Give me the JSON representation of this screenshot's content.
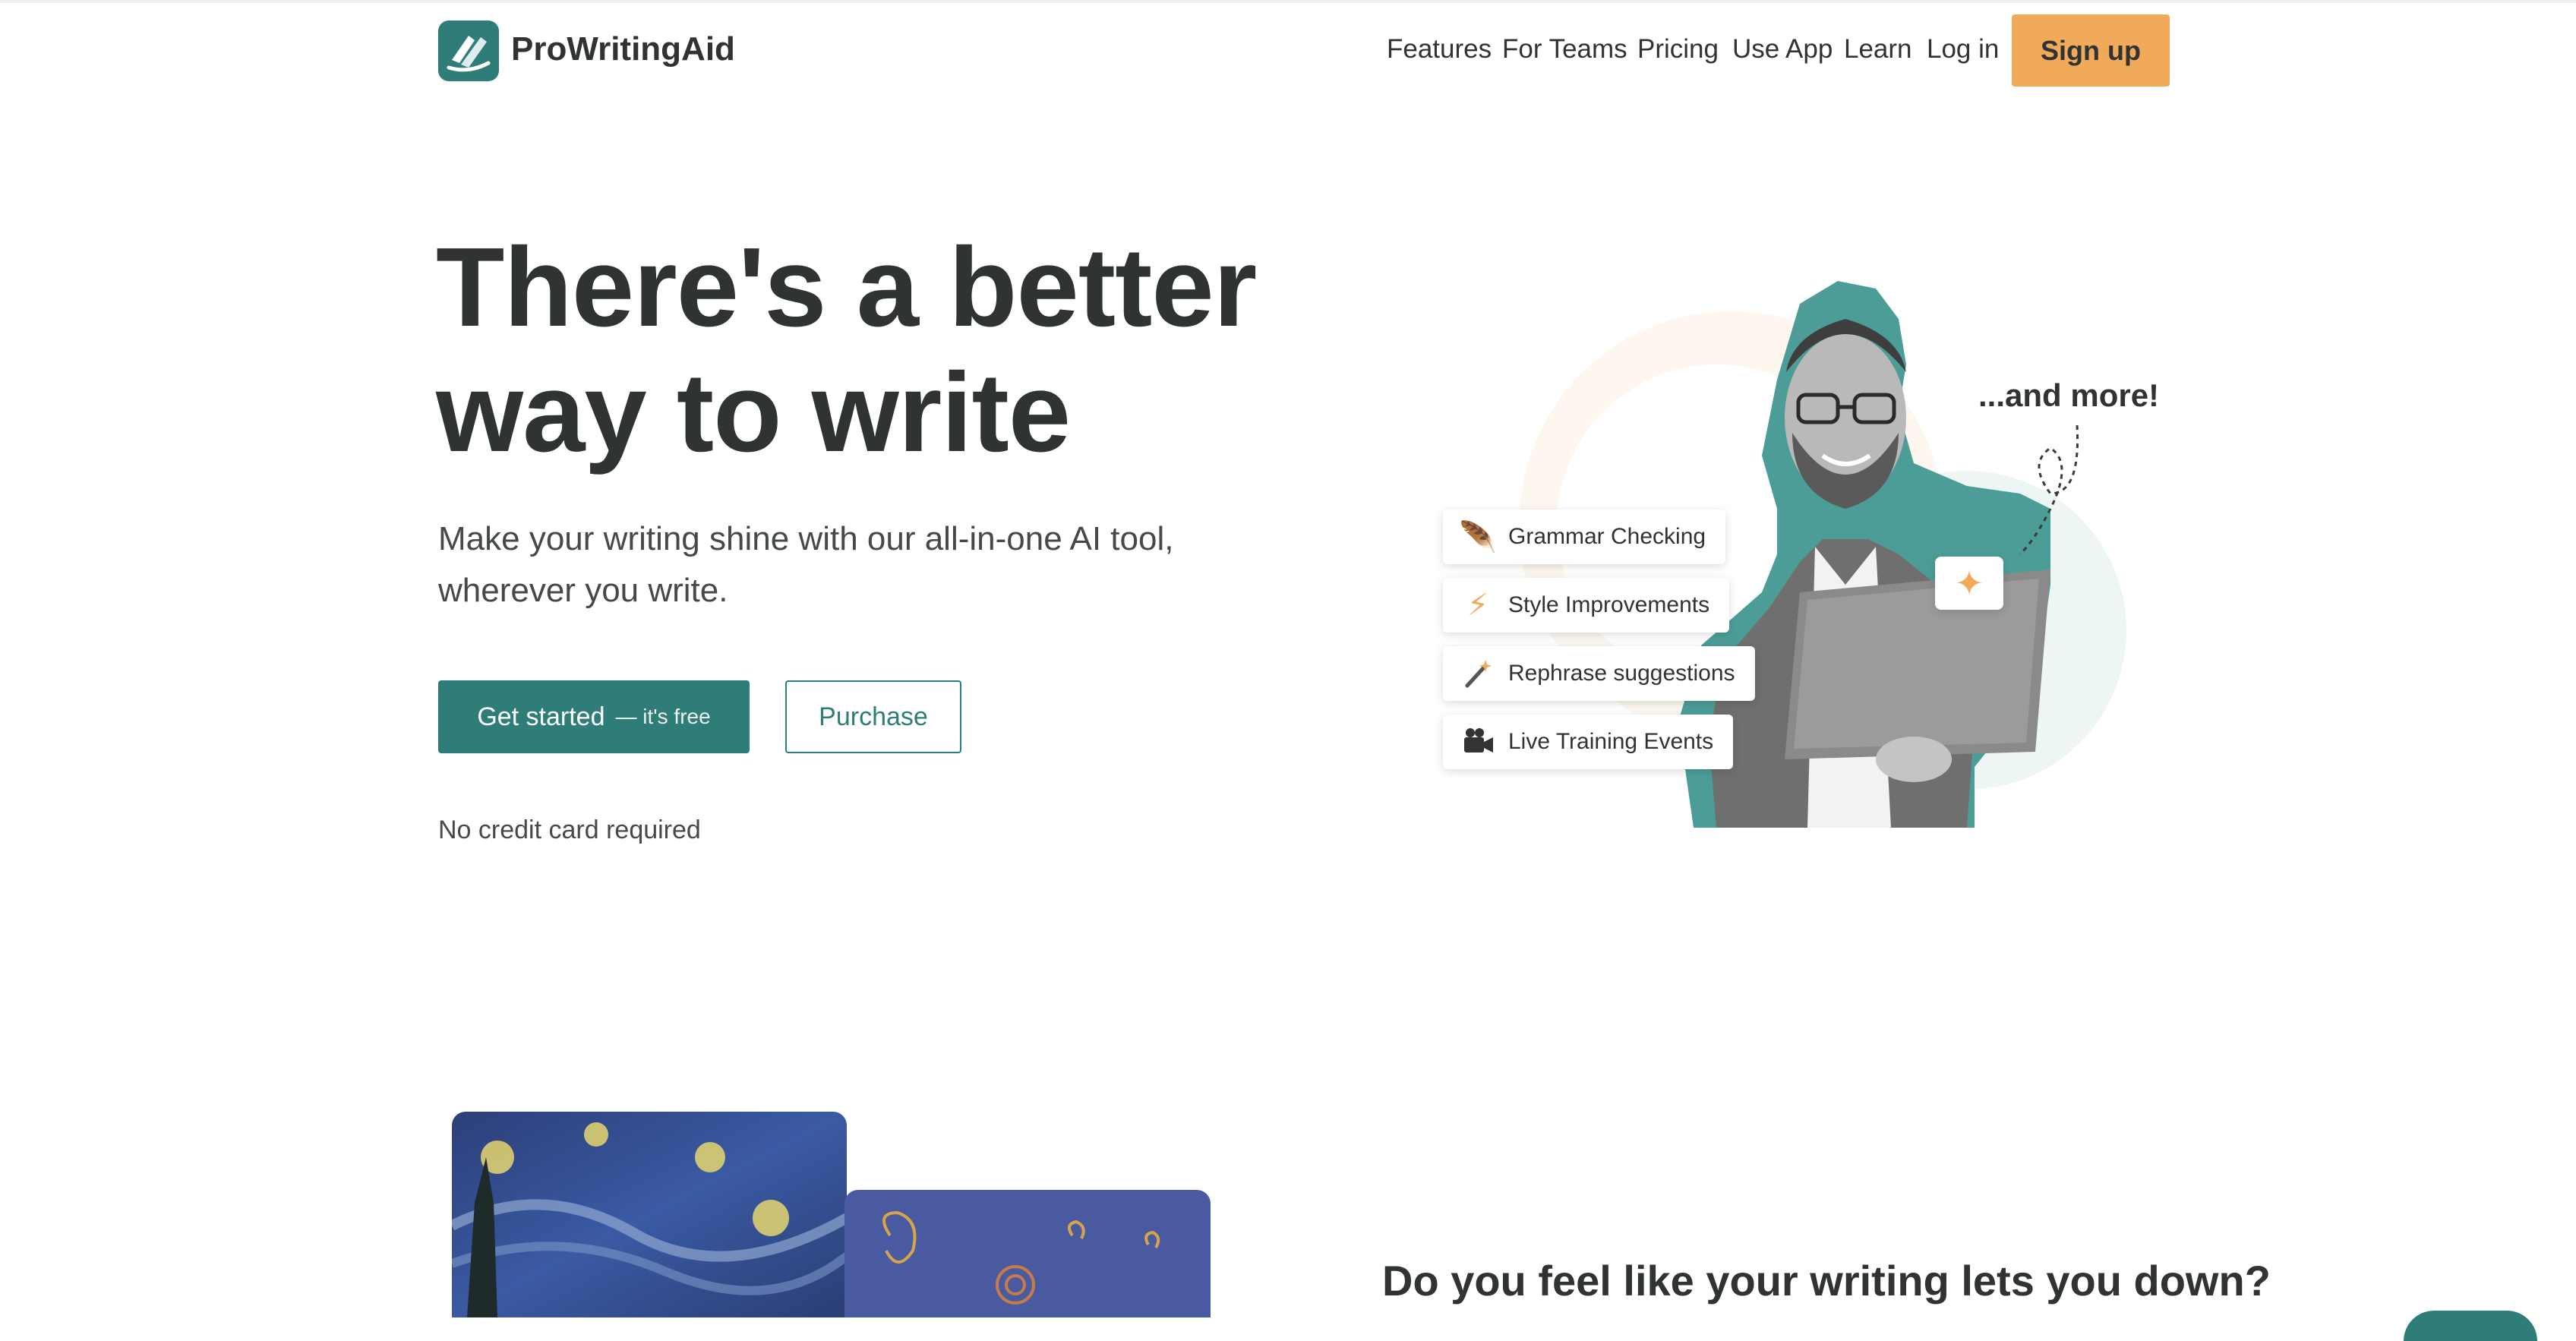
{
  "header": {
    "brand": "ProWritingAid",
    "nav": [
      "Features",
      "For Teams",
      "Pricing",
      "Use App",
      "Learn",
      "Log in"
    ],
    "signup_label": "Sign up"
  },
  "hero": {
    "title_line1": "There's a better",
    "title_line2": "way to write",
    "subtitle": "Make your writing shine with our all-in-one AI tool, wherever you write.",
    "cta_primary": "Get started",
    "cta_primary_note": "— it's free",
    "cta_secondary": "Purchase",
    "note": "No credit card required"
  },
  "illustration": {
    "features": [
      {
        "label": "Grammar Checking",
        "icon": "feather-icon"
      },
      {
        "label": "Style Improvements",
        "icon": "lightning-icon"
      },
      {
        "label": "Rephrase suggestions",
        "icon": "magic-wand-icon"
      },
      {
        "label": "Live Training Events",
        "icon": "video-camera-icon"
      }
    ],
    "more_label": "...and more!",
    "sparkle_icon": "sparkle-icon"
  },
  "section2": {
    "question": "Do you feel like your writing lets you down?"
  },
  "colors": {
    "brand_teal": "#2f7d78",
    "accent_orange": "#f1a95a",
    "text_dark": "#303334"
  }
}
